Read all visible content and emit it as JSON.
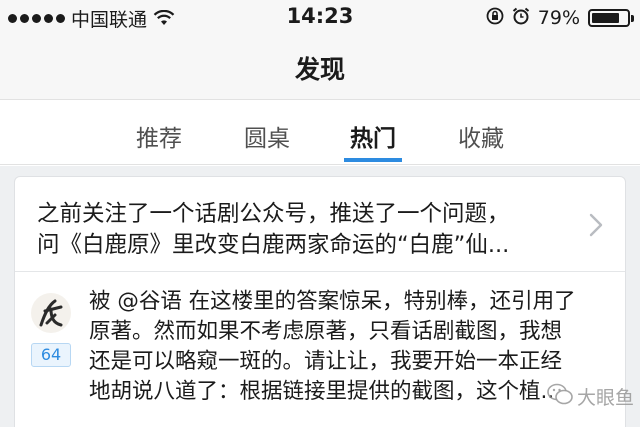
{
  "status_bar": {
    "carrier": "中国联通",
    "time": "14:23",
    "battery": "79%",
    "battery_level": 0.79,
    "icons": [
      "signal-dots-icon",
      "wifi-icon",
      "orientation-lock-icon",
      "alarm-icon",
      "battery-icon"
    ]
  },
  "nav": {
    "title": "发现"
  },
  "tabs": [
    {
      "label": "推荐",
      "active": false
    },
    {
      "label": "圆桌",
      "active": false
    },
    {
      "label": "热门",
      "active": true
    },
    {
      "label": "收藏",
      "active": false
    }
  ],
  "card": {
    "question_lines": [
      "之前关注了一个话剧公众号，推送了一个问题，",
      "问《白鹿原》里改变白鹿两家命运的“白鹿”仙..."
    ],
    "vote_count": "64",
    "answer_lines": [
      "被 @谷语 在这楼里的答案惊呆，特别棒，还引用了",
      "原著。然而如果不考虑原著，只看话剧截图，我想",
      "还是可以略窥一斑的。请让让，我要开始一本正经",
      "地胡说八道了：根据链接里提供的截图，这个植..."
    ]
  },
  "colors": {
    "accent": "#2d8be0",
    "background": "#eef0f2"
  },
  "watermark": {
    "text": "大眼鱼",
    "icon": "wechat-icon"
  }
}
